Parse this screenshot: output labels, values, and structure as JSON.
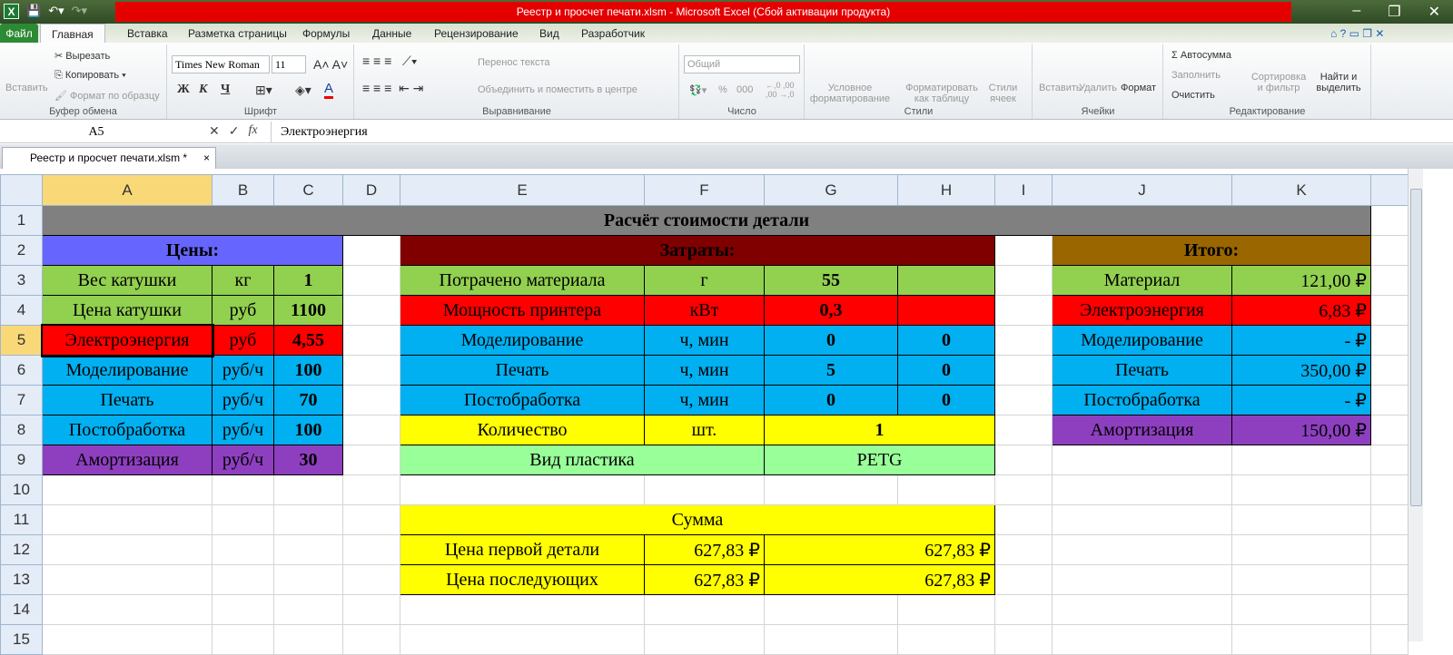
{
  "window": {
    "title": "Реестр и просчет печати.xlsm  -  Microsoft Excel (Сбой активации продукта)",
    "minimize": "–",
    "restore": "❐",
    "close": "✕"
  },
  "ribbon_tabs": [
    "Файл",
    "Главная",
    "Вставка",
    "Разметка страницы",
    "Формулы",
    "Данные",
    "Рецензирование",
    "Вид",
    "Разработчик"
  ],
  "clipboard": {
    "paste": "Вставить",
    "cut": "Вырезать",
    "copy": "Копировать",
    "format_painter": "Формат по образцу",
    "label": "Буфер обмена"
  },
  "font": {
    "name": "Times New Roman",
    "size": "11",
    "bold": "Ж",
    "italic": "К",
    "underline": "Ч",
    "label": "Шрифт"
  },
  "alignment": {
    "wrap": "Перенос текста",
    "merge": "Объединить и поместить в центре",
    "label": "Выравнивание"
  },
  "number": {
    "format": "Общий",
    "percent": "%",
    "thousands": "000",
    "label": "Число"
  },
  "styles": {
    "conditional": "Условное форматирование",
    "as_table": "Форматировать как таблицу",
    "cell_styles": "Стили ячеек",
    "label": "Стили"
  },
  "cells": {
    "insert": "Вставить",
    "delete": "Удалить",
    "format": "Формат",
    "label": "Ячейки"
  },
  "editing": {
    "autosum": "Σ Автосумма",
    "fill": "Заполнить",
    "clear": "Очистить",
    "sort": "Сортировка и фильтр",
    "find": "Найти и выделить",
    "label": "Редактирование"
  },
  "formula_bar": {
    "name_box": "A5",
    "fx": "fx",
    "value": "Электроэнергия"
  },
  "doc_tab": {
    "name": "Реестр и просчет печати.xlsm *",
    "close": "×"
  },
  "columns": [
    "A",
    "B",
    "C",
    "D",
    "E",
    "F",
    "G",
    "H",
    "I",
    "J",
    "K",
    ""
  ],
  "selected_column": "A",
  "selected_row": "5",
  "colors": {
    "gray": "#808080",
    "blue_header": "#6666FF",
    "dark_red": "#800000",
    "brown": "#996600",
    "green": "#92D050",
    "red": "#FF0000",
    "cyan": "#00B0F0",
    "purple": "#8E3FBF",
    "yellow": "#FFFF00",
    "light_green": "#99FF99"
  },
  "rows": [
    {
      "n": "1",
      "cells": [
        {
          "c": "A",
          "span": 11,
          "t": "Расчёт стоимости детали",
          "bg": "gray",
          "b": 1
        }
      ]
    },
    {
      "n": "2",
      "cells": [
        {
          "c": "A",
          "span": 3,
          "t": "Цены:",
          "bg": "blue_header",
          "b": 1
        },
        {
          "c": "E",
          "span": 4,
          "t": "Затраты:",
          "bg": "dark_red",
          "b": 1
        },
        {
          "c": "J",
          "span": 2,
          "t": "Итого:",
          "bg": "brown",
          "b": 1
        }
      ]
    },
    {
      "n": "3",
      "cells": [
        {
          "c": "A",
          "t": "Вес катушки",
          "bg": "green"
        },
        {
          "c": "B",
          "t": "кг",
          "bg": "green"
        },
        {
          "c": "C",
          "t": "1",
          "bg": "green",
          "b": 1
        },
        {
          "c": "E",
          "t": "Потрачено материала",
          "bg": "green"
        },
        {
          "c": "F",
          "t": "г",
          "bg": "green"
        },
        {
          "c": "G",
          "t": "55",
          "bg": "green",
          "b": 1
        },
        {
          "c": "H",
          "t": "",
          "bg": "green"
        },
        {
          "c": "J",
          "t": "Материал",
          "bg": "green"
        },
        {
          "c": "K",
          "t": "121,00 ₽",
          "bg": "green",
          "r": 1
        }
      ]
    },
    {
      "n": "4",
      "cells": [
        {
          "c": "A",
          "t": "Цена катушки",
          "bg": "green"
        },
        {
          "c": "B",
          "t": "руб",
          "bg": "green"
        },
        {
          "c": "C",
          "t": "1100",
          "bg": "green",
          "b": 1
        },
        {
          "c": "E",
          "t": "Мощность принтера",
          "bg": "red"
        },
        {
          "c": "F",
          "t": "кВт",
          "bg": "red"
        },
        {
          "c": "G",
          "t": "0,3",
          "bg": "red",
          "b": 1
        },
        {
          "c": "H",
          "t": "",
          "bg": "red"
        },
        {
          "c": "J",
          "t": "Электроэнергия",
          "bg": "red"
        },
        {
          "c": "K",
          "t": "6,83 ₽",
          "bg": "red",
          "r": 1
        }
      ]
    },
    {
      "n": "5",
      "cells": [
        {
          "c": "A",
          "t": "Электроэнергия",
          "bg": "red"
        },
        {
          "c": "B",
          "t": "руб",
          "bg": "red"
        },
        {
          "c": "C",
          "t": "4,55",
          "bg": "red",
          "b": 1
        },
        {
          "c": "E",
          "t": "Моделирование",
          "bg": "cyan"
        },
        {
          "c": "F",
          "t": "ч, мин",
          "bg": "cyan"
        },
        {
          "c": "G",
          "t": "0",
          "bg": "cyan",
          "b": 1
        },
        {
          "c": "H",
          "t": "0",
          "bg": "cyan",
          "b": 1
        },
        {
          "c": "J",
          "t": "Моделирование",
          "bg": "cyan"
        },
        {
          "c": "K",
          "t": "-     ₽",
          "bg": "cyan",
          "r": 1
        }
      ]
    },
    {
      "n": "6",
      "cells": [
        {
          "c": "A",
          "t": "Моделирование",
          "bg": "cyan"
        },
        {
          "c": "B",
          "t": "руб/ч",
          "bg": "cyan"
        },
        {
          "c": "C",
          "t": "100",
          "bg": "cyan",
          "b": 1
        },
        {
          "c": "E",
          "t": "Печать",
          "bg": "cyan"
        },
        {
          "c": "F",
          "t": "ч, мин",
          "bg": "cyan"
        },
        {
          "c": "G",
          "t": "5",
          "bg": "cyan",
          "b": 1
        },
        {
          "c": "H",
          "t": "0",
          "bg": "cyan",
          "b": 1
        },
        {
          "c": "J",
          "t": "Печать",
          "bg": "cyan"
        },
        {
          "c": "K",
          "t": "350,00 ₽",
          "bg": "cyan",
          "r": 1
        }
      ]
    },
    {
      "n": "7",
      "cells": [
        {
          "c": "A",
          "t": "Печать",
          "bg": "cyan"
        },
        {
          "c": "B",
          "t": "руб/ч",
          "bg": "cyan"
        },
        {
          "c": "C",
          "t": "70",
          "bg": "cyan",
          "b": 1
        },
        {
          "c": "E",
          "t": "Постобработка",
          "bg": "cyan"
        },
        {
          "c": "F",
          "t": "ч, мин",
          "bg": "cyan"
        },
        {
          "c": "G",
          "t": "0",
          "bg": "cyan",
          "b": 1
        },
        {
          "c": "H",
          "t": "0",
          "bg": "cyan",
          "b": 1
        },
        {
          "c": "J",
          "t": "Постобработка",
          "bg": "cyan"
        },
        {
          "c": "K",
          "t": "-     ₽",
          "bg": "cyan",
          "r": 1
        }
      ]
    },
    {
      "n": "8",
      "cells": [
        {
          "c": "A",
          "t": "Постобработка",
          "bg": "cyan"
        },
        {
          "c": "B",
          "t": "руб/ч",
          "bg": "cyan"
        },
        {
          "c": "C",
          "t": "100",
          "bg": "cyan",
          "b": 1
        },
        {
          "c": "E",
          "t": "Количество",
          "bg": "yellow"
        },
        {
          "c": "F",
          "t": "шт.",
          "bg": "yellow"
        },
        {
          "c": "G",
          "span": 2,
          "t": "1",
          "bg": "yellow",
          "b": 1
        },
        {
          "c": "J",
          "t": "Амортизация",
          "bg": "purple"
        },
        {
          "c": "K",
          "t": "150,00 ₽",
          "bg": "purple",
          "r": 1
        }
      ]
    },
    {
      "n": "9",
      "cells": [
        {
          "c": "A",
          "t": "Амортизация",
          "bg": "purple"
        },
        {
          "c": "B",
          "t": "руб/ч",
          "bg": "purple"
        },
        {
          "c": "C",
          "t": "30",
          "bg": "purple",
          "b": 1
        },
        {
          "c": "E",
          "span": 2,
          "t": "Вид пластика",
          "bg": "light_green"
        },
        {
          "c": "G",
          "span": 2,
          "t": "PETG",
          "bg": "light_green"
        }
      ]
    },
    {
      "n": "10",
      "cells": []
    },
    {
      "n": "11",
      "cells": [
        {
          "c": "E",
          "span": 4,
          "t": "Сумма",
          "bg": "yellow"
        }
      ]
    },
    {
      "n": "12",
      "cells": [
        {
          "c": "E",
          "t": "Цена первой детали",
          "bg": "yellow"
        },
        {
          "c": "F",
          "t": "627,83 ₽",
          "bg": "yellow",
          "r": 1
        },
        {
          "c": "G",
          "span": 2,
          "t": "627,83 ₽",
          "bg": "yellow",
          "r": 1
        }
      ]
    },
    {
      "n": "13",
      "cells": [
        {
          "c": "E",
          "t": "Цена последующих",
          "bg": "yellow"
        },
        {
          "c": "F",
          "t": "627,83 ₽",
          "bg": "yellow",
          "r": 1
        },
        {
          "c": "G",
          "span": 2,
          "t": "627,83 ₽",
          "bg": "yellow",
          "r": 1
        }
      ]
    },
    {
      "n": "14",
      "cells": []
    },
    {
      "n": "15",
      "cells": []
    }
  ]
}
